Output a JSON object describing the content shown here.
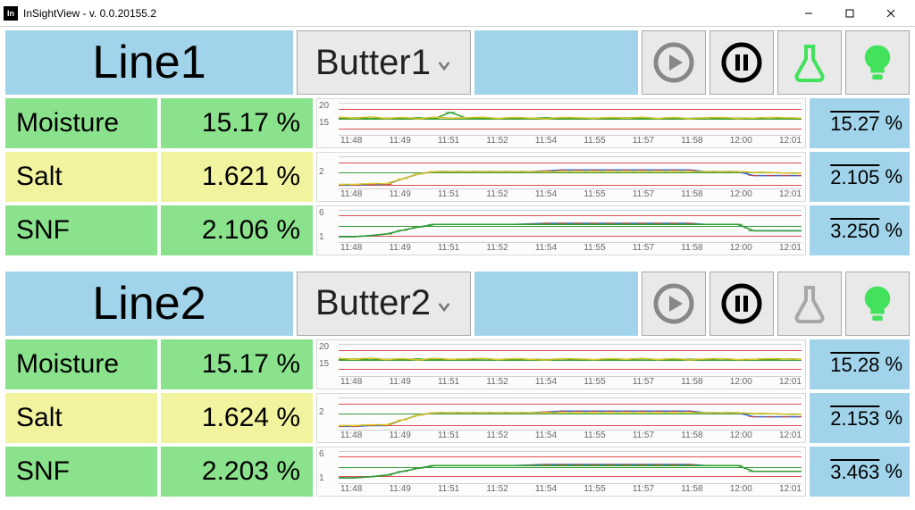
{
  "window": {
    "title": "InSightView - v. 0.0.20155.2",
    "icon_text": "In"
  },
  "chart_data": {
    "x_labels": [
      "11:48",
      "11:49",
      "11:51",
      "11:52",
      "11:54",
      "11:55",
      "11:57",
      "11:58",
      "12:00",
      "12:01"
    ],
    "lines": [
      {
        "name": "Line1",
        "recipe_selected": "Butter1",
        "beaker_active": true,
        "measurements": [
          {
            "key": "moisture",
            "label": "Moisture",
            "value": "15.17",
            "unit": "%",
            "color": "green",
            "avg": "15.27",
            "y_ticks": [
              "20",
              "15",
              ""
            ],
            "y_range": [
              10,
              20
            ],
            "limits": {
              "upper": 18,
              "target": 15,
              "lower": 12
            },
            "series": [
              {
                "style": "green",
                "v": [
                  15.1,
                  15.3,
                  15.0,
                  15.2,
                  15.1,
                  15.3,
                  15.0,
                  17.0,
                  15.2,
                  15.1,
                  15.0,
                  15.2,
                  15.1,
                  15.3,
                  15.1,
                  15.0,
                  15.2,
                  15.1,
                  15.3,
                  15.1,
                  15.0,
                  15.2,
                  15.1,
                  15.3,
                  15.0,
                  15.2,
                  15.1,
                  15.3,
                  15.1,
                  15.2
                ]
              },
              {
                "style": "yellow",
                "v": [
                  15.5,
                  15.2,
                  15.6,
                  15.1,
                  15.4,
                  15.0,
                  15.5,
                  15.2,
                  15.3,
                  15.5,
                  15.1,
                  15.4,
                  15.2,
                  15.0,
                  15.4,
                  15.3,
                  15.1,
                  15.4,
                  15.2,
                  15.5,
                  15.1,
                  15.4,
                  15.0,
                  15.3,
                  15.4,
                  15.1,
                  15.2,
                  15.4,
                  15.3,
                  15.2
                ]
              }
            ]
          },
          {
            "key": "salt",
            "label": "Salt",
            "value": "1.621",
            "unit": "%",
            "color": "yellow",
            "avg": "2.105",
            "y_ticks": [
              "",
              "2",
              ""
            ],
            "y_range": [
              0,
              4
            ],
            "limits": {
              "upper": 3.2,
              "target": 2.0,
              "lower": 0.5
            },
            "series": [
              {
                "style": "blue-red",
                "v": [
                  0.4,
                  0.4,
                  0.5,
                  0.5,
                  1.2,
                  1.8,
                  2.1,
                  2.1,
                  2.1,
                  2.1,
                  2.1,
                  2.1,
                  2.1,
                  2.2,
                  2.3,
                  2.3,
                  2.3,
                  2.3,
                  2.3,
                  2.3,
                  2.3,
                  2.3,
                  2.3,
                  2.1,
                  2.1,
                  2.1,
                  1.6,
                  1.6,
                  1.6,
                  1.6
                ]
              },
              {
                "style": "yellow",
                "v": [
                  0.5,
                  0.5,
                  0.6,
                  0.6,
                  1.2,
                  1.8,
                  2.1,
                  2.1,
                  2.1,
                  2.1,
                  2.1,
                  2.1,
                  2.1,
                  2.1,
                  2.1,
                  2.1,
                  2.1,
                  2.1,
                  2.1,
                  2.1,
                  2.1,
                  2.1,
                  2.1,
                  2.1,
                  2.1,
                  2.1,
                  2.0,
                  2.0,
                  1.9,
                  1.9
                ]
              }
            ]
          },
          {
            "key": "snf",
            "label": "SNF",
            "value": "2.106",
            "unit": "%",
            "color": "green",
            "avg": "3.250",
            "y_ticks": [
              "6",
              "",
              "1"
            ],
            "y_range": [
              0,
              6
            ],
            "limits": {
              "upper": 5.0,
              "target": 3.0,
              "lower": 1.2
            },
            "series": [
              {
                "style": "blue-red",
                "v": [
                  1.0,
                  1.0,
                  1.2,
                  1.5,
                  2.2,
                  2.8,
                  3.3,
                  3.3,
                  3.3,
                  3.3,
                  3.3,
                  3.3,
                  3.4,
                  3.5,
                  3.5,
                  3.5,
                  3.5,
                  3.5,
                  3.5,
                  3.5,
                  3.5,
                  3.5,
                  3.5,
                  3.3,
                  3.3,
                  3.3,
                  2.1,
                  2.1,
                  2.1,
                  2.1
                ]
              },
              {
                "style": "green",
                "v": [
                  1.0,
                  1.0,
                  1.2,
                  1.5,
                  2.2,
                  2.8,
                  3.3,
                  3.3,
                  3.3,
                  3.3,
                  3.3,
                  3.3,
                  3.3,
                  3.3,
                  3.3,
                  3.3,
                  3.3,
                  3.3,
                  3.3,
                  3.3,
                  3.3,
                  3.3,
                  3.3,
                  3.3,
                  3.3,
                  3.3,
                  2.1,
                  2.1,
                  2.1,
                  2.1
                ]
              }
            ]
          }
        ]
      },
      {
        "name": "Line2",
        "recipe_selected": "Butter2",
        "beaker_active": false,
        "measurements": [
          {
            "key": "moisture",
            "label": "Moisture",
            "value": "15.17",
            "unit": "%",
            "color": "green",
            "avg": "15.28",
            "y_ticks": [
              "20",
              "15",
              ""
            ],
            "y_range": [
              10,
              20
            ],
            "limits": {
              "upper": 18,
              "target": 15,
              "lower": 12
            },
            "series": [
              {
                "style": "green",
                "v": [
                  15.1,
                  15.3,
                  15.0,
                  15.2,
                  15.1,
                  15.3,
                  15.0,
                  15.2,
                  15.1,
                  15.3,
                  15.1,
                  15.0,
                  15.2,
                  15.1,
                  15.3,
                  15.1,
                  15.0,
                  15.2,
                  15.1,
                  15.3,
                  15.1,
                  15.0,
                  15.2,
                  15.1,
                  15.3,
                  15.0,
                  15.2,
                  15.1,
                  15.3,
                  15.2
                ]
              },
              {
                "style": "yellow",
                "v": [
                  15.5,
                  15.2,
                  15.6,
                  15.1,
                  15.4,
                  15.0,
                  15.5,
                  15.2,
                  15.3,
                  15.5,
                  15.1,
                  15.4,
                  15.2,
                  15.0,
                  15.4,
                  15.3,
                  15.1,
                  15.4,
                  15.2,
                  15.5,
                  15.1,
                  15.4,
                  15.0,
                  15.3,
                  15.4,
                  15.1,
                  15.2,
                  15.4,
                  15.3,
                  15.2
                ]
              }
            ]
          },
          {
            "key": "salt",
            "label": "Salt",
            "value": "1.624",
            "unit": "%",
            "color": "yellow",
            "avg": "2.153",
            "y_ticks": [
              "",
              "2",
              ""
            ],
            "y_range": [
              0,
              4
            ],
            "limits": {
              "upper": 3.2,
              "target": 2.0,
              "lower": 0.5
            },
            "series": [
              {
                "style": "blue-red",
                "v": [
                  0.4,
                  0.4,
                  0.5,
                  0.5,
                  1.2,
                  1.8,
                  2.1,
                  2.1,
                  2.1,
                  2.1,
                  2.1,
                  2.1,
                  2.1,
                  2.2,
                  2.3,
                  2.3,
                  2.3,
                  2.3,
                  2.3,
                  2.3,
                  2.3,
                  2.3,
                  2.3,
                  2.1,
                  2.1,
                  2.1,
                  1.6,
                  1.6,
                  1.6,
                  1.6
                ]
              },
              {
                "style": "yellow",
                "v": [
                  0.5,
                  0.5,
                  0.6,
                  0.6,
                  1.2,
                  1.8,
                  2.1,
                  2.1,
                  2.1,
                  2.1,
                  2.1,
                  2.1,
                  2.1,
                  2.1,
                  2.1,
                  2.1,
                  2.1,
                  2.1,
                  2.1,
                  2.1,
                  2.1,
                  2.1,
                  2.1,
                  2.1,
                  2.1,
                  2.1,
                  2.0,
                  2.0,
                  1.9,
                  1.9
                ]
              }
            ]
          },
          {
            "key": "snf",
            "label": "SNF",
            "value": "2.203",
            "unit": "%",
            "color": "green",
            "avg": "3.463",
            "y_ticks": [
              "6",
              "",
              "1"
            ],
            "y_range": [
              0,
              6
            ],
            "limits": {
              "upper": 5.0,
              "target": 3.0,
              "lower": 1.2
            },
            "series": [
              {
                "style": "blue-red",
                "v": [
                  1.0,
                  1.0,
                  1.2,
                  1.5,
                  2.2,
                  2.8,
                  3.3,
                  3.3,
                  3.3,
                  3.3,
                  3.3,
                  3.3,
                  3.4,
                  3.5,
                  3.5,
                  3.5,
                  3.5,
                  3.5,
                  3.5,
                  3.5,
                  3.5,
                  3.5,
                  3.5,
                  3.3,
                  3.3,
                  3.3,
                  2.2,
                  2.2,
                  2.2,
                  2.2
                ]
              },
              {
                "style": "green",
                "v": [
                  1.0,
                  1.0,
                  1.2,
                  1.5,
                  2.2,
                  2.8,
                  3.3,
                  3.3,
                  3.3,
                  3.3,
                  3.3,
                  3.3,
                  3.3,
                  3.3,
                  3.3,
                  3.3,
                  3.3,
                  3.3,
                  3.3,
                  3.3,
                  3.3,
                  3.3,
                  3.3,
                  3.3,
                  3.3,
                  3.3,
                  2.2,
                  2.2,
                  2.2,
                  2.2
                ]
              }
            ]
          }
        ]
      }
    ]
  }
}
